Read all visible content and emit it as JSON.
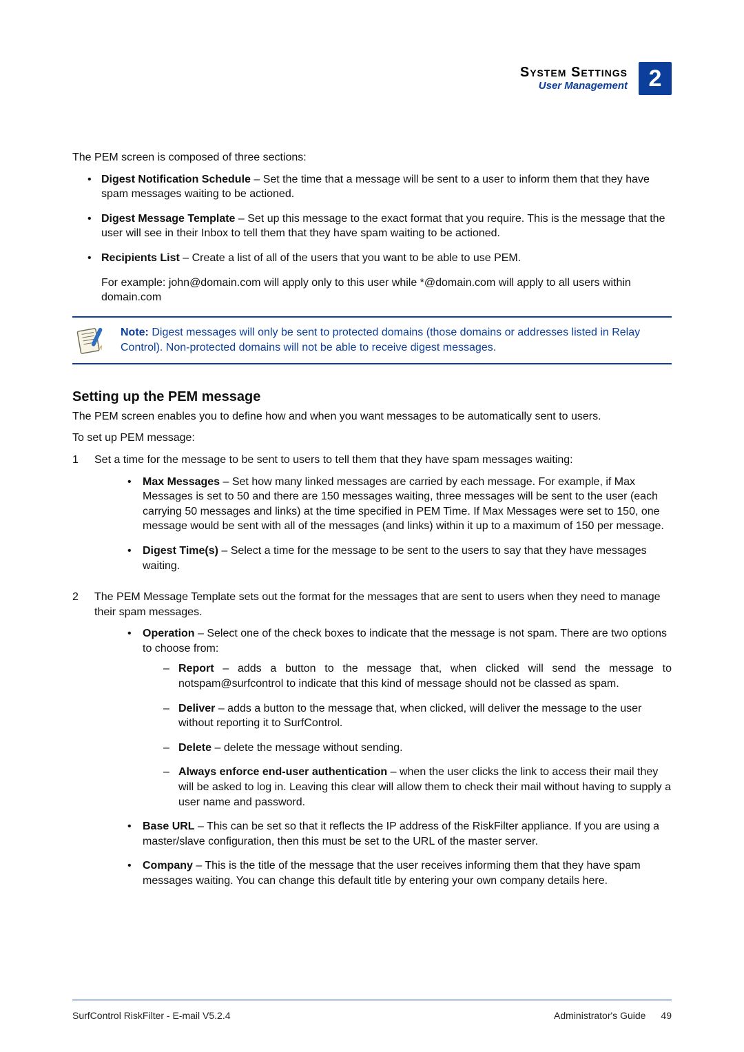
{
  "header": {
    "section_title": "System Settings",
    "subsection": "User Management",
    "chapter_number": "2"
  },
  "intro": "The PEM screen is composed of three sections:",
  "top_bullets": [
    {
      "term": "Digest Notification Schedule",
      "text": " – Set the time that a message will be sent to a user to inform them that they have spam messages waiting to be actioned."
    },
    {
      "term": "Digest Message Template",
      "text": " – Set up this message to the exact format that you require. This is the message that the user will see in their Inbox to tell them that they have spam waiting to be actioned."
    },
    {
      "term": "Recipients List",
      "text": " – Create a list of all of the users that you want to be able to use PEM."
    }
  ],
  "recipients_example": "For example: john@domain.com will apply only to this user while *@domain.com will apply to all users within domain.com",
  "note": {
    "label": "Note:  ",
    "text": "Digest messages will only be sent to protected domains (those domains or addresses listed in Relay Control). Non-protected domains will not be able to receive digest messages."
  },
  "h3": "Setting up the PEM message",
  "h3_intro": "The PEM screen enables you to define how and when you want messages to be automatically sent to users.",
  "procedure_lead": "To set up PEM message:",
  "steps": [
    {
      "num": "1",
      "text": "Set a time for the message to be sent to users to tell them that they have spam messages waiting:",
      "subs": [
        {
          "term": "Max Messages",
          "text": " – Set how many linked messages are carried by each message. For example, if Max Messages is set to 50 and there are 150 messages waiting, three messages will be sent to the user (each carrying 50 messages and links) at the time specified in PEM Time. If Max Messages were set to 150, one message would be sent with all of the messages (and links) within it up to a maximum of 150 per message."
        },
        {
          "term": "Digest Time(s)",
          "text": " – Select a time for the message to be sent to the users to say that they have messages waiting."
        }
      ]
    },
    {
      "num": "2",
      "text": "The PEM Message Template sets out the format for the messages that are sent to users when they need to manage their spam messages.",
      "subs": [
        {
          "term": "Operation",
          "text": " – Select one of the check boxes to indicate that the message is not spam. There are two options to choose from:",
          "dashes": [
            {
              "term": "Report",
              "text": " – adds a button to the message that, when clicked will send the message to notspam@surfcontrol to indicate that this kind of message should not be classed as spam."
            },
            {
              "term": "Deliver",
              "text": " – adds a button to the message that, when clicked, will deliver the message to the user without reporting it to SurfControl."
            },
            {
              "term": "Delete",
              "text": " – delete the message without sending."
            },
            {
              "term": "Always enforce end-user authentication",
              "text": " – when the user clicks the link to access their mail they will be asked to log in. Leaving this clear will allow them to check their mail without having to supply a user name and password."
            }
          ]
        },
        {
          "term": "Base URL",
          "text": " – This can be set so that it reflects the IP address of the RiskFilter appliance. If you are using a master/slave configuration, then this must be set to the URL of the master server."
        },
        {
          "term": "Company",
          "text": " – This is the title of the message that the user receives informing them that they have spam messages waiting. You can change this default title by entering your own company details here."
        }
      ]
    }
  ],
  "footer": {
    "left": "SurfControl RiskFilter - E-mail V5.2.4",
    "right_label": "Administrator's Guide",
    "page_number": "49"
  }
}
